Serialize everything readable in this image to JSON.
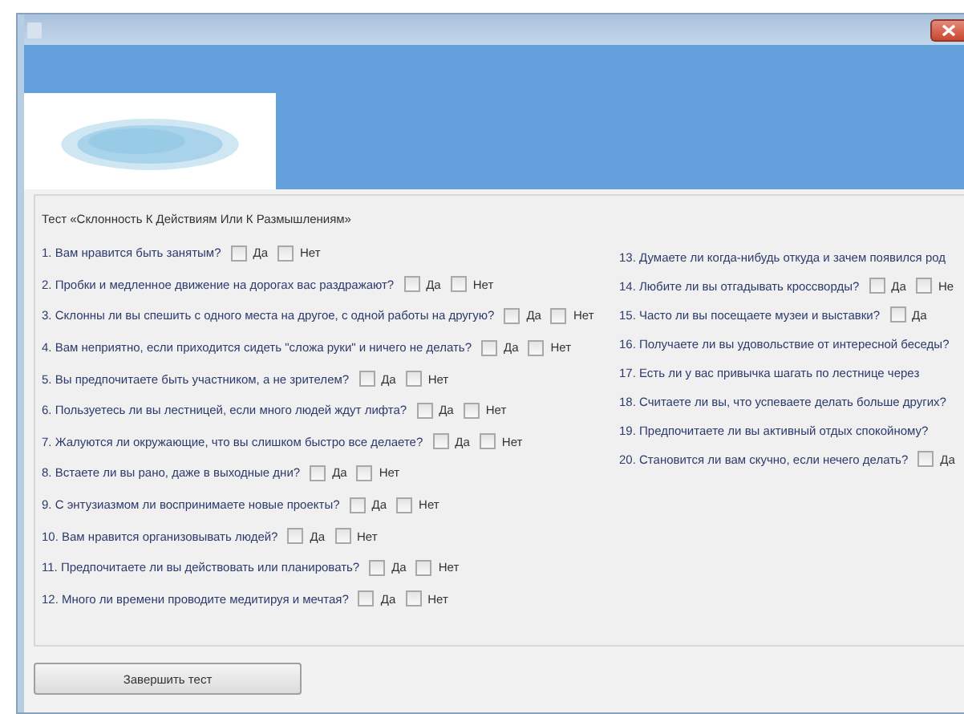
{
  "test_title": "Тест «Склонность К Действиям Или К Размышлениям»",
  "left_questions": [
    {
      "text": "1. Вам нравится быть занятым?",
      "options": [
        {
          "label": "Да",
          "checked": false
        },
        {
          "label": "Нет",
          "checked": false
        }
      ]
    },
    {
      "text": "2. Пробки и медленное движение на дорогах вас раздражают?",
      "options": [
        {
          "label": "Да",
          "checked": false
        },
        {
          "label": "Нет",
          "checked": false
        }
      ]
    },
    {
      "text": "3. Склонны ли вы спешить с одного места на другое, с одной работы на другую?",
      "options": [
        {
          "label": "Да",
          "checked": false
        },
        {
          "label": "Нет",
          "checked": false
        }
      ]
    },
    {
      "text": "4. Вам неприятно, если приходится сидеть \"сложа руки\" и ничего не делать?",
      "options": [
        {
          "label": "Да",
          "checked": false
        },
        {
          "label": "Нет",
          "checked": false
        }
      ]
    },
    {
      "text": "5. Вы предпочитаете быть участником, а не зрителем?",
      "options": [
        {
          "label": "Да",
          "checked": false
        },
        {
          "label": "Нет",
          "checked": false
        }
      ]
    },
    {
      "text": "6. Пользуетесь ли вы лестницей, если много людей ждут лифта?",
      "options": [
        {
          "label": "Да",
          "checked": false
        },
        {
          "label": "Нет",
          "checked": false
        }
      ]
    },
    {
      "text": "7. Жалуются ли окружающие, что вы слишком быстро все делаете?",
      "options": [
        {
          "label": "Да",
          "checked": false
        },
        {
          "label": "Нет",
          "checked": false
        }
      ]
    },
    {
      "text": "8. Встаете ли вы рано, даже в выходные дни?",
      "options": [
        {
          "label": "Да",
          "checked": false
        },
        {
          "label": "Нет",
          "checked": false
        }
      ]
    },
    {
      "text": "9. С энтузиазмом ли воспринимаете новые проекты?",
      "options": [
        {
          "label": "Да",
          "checked": false
        },
        {
          "label": "Нет",
          "checked": false
        }
      ]
    },
    {
      "text": "10. Вам нравится организовывать людей?",
      "options": [
        {
          "label": "Да",
          "checked": false
        },
        {
          "label": "Нет",
          "checked": false
        }
      ]
    },
    {
      "text": "11. Предпочитаете ли вы действовать или планировать?",
      "options": [
        {
          "label": "Да",
          "checked": false
        },
        {
          "label": "Нет",
          "checked": false
        }
      ]
    },
    {
      "text": "12. Много ли времени проводите медитируя и мечтая?",
      "options": [
        {
          "label": "Да",
          "checked": false
        },
        {
          "label": "Нет",
          "checked": false
        }
      ]
    }
  ],
  "right_questions": [
    {
      "text": "13. Думаете ли когда-нибудь откуда и зачем появился род"
    },
    {
      "text": "14. Любите ли вы отгадывать кроссворды?",
      "options": [
        {
          "label": "Да",
          "checked": false
        },
        {
          "label": "Не",
          "checked": false
        }
      ]
    },
    {
      "text": "15. Часто ли вы посещаете музеи и выставки?",
      "options": [
        {
          "label": "Да",
          "checked": false
        }
      ]
    },
    {
      "text": "16. Получаете ли вы удовольствие от интересной беседы?"
    },
    {
      "text": "17. Есть ли у вас привычка шагать по лестнице через"
    },
    {
      "text": "18. Считаете ли вы, что успеваете делать больше других?"
    },
    {
      "text": "19. Предпочитаете ли вы активный отдых спокойному?"
    },
    {
      "text": "20. Становится ли вам скучно, если нечего делать?",
      "options": [
        {
          "label": "Да",
          "checked": false
        }
      ]
    }
  ],
  "finish_button": "Завершить тест"
}
